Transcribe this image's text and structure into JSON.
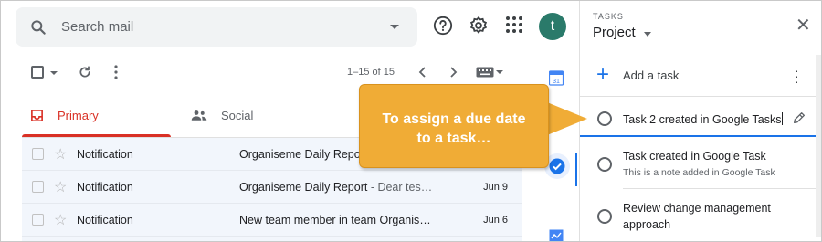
{
  "search": {
    "placeholder": "Search mail"
  },
  "avatar": {
    "initial": "t",
    "color": "#2a7a6a"
  },
  "toolbar": {
    "pagination": "1–15 of 15"
  },
  "tabs": [
    {
      "label": "Primary",
      "active": true
    },
    {
      "label": "Social",
      "active": false
    }
  ],
  "emails": [
    {
      "sender": "Notification",
      "subject": "Organiseme Daily Report",
      "snippet": "",
      "date": ""
    },
    {
      "sender": "Notification",
      "subject": "Organiseme Daily Report",
      "snippet": " - Dear tes…",
      "date": "Jun 9"
    },
    {
      "sender": "Notification",
      "subject": "New team member in team Organis…",
      "snippet": "",
      "date": "Jun 6"
    }
  ],
  "tasks_panel": {
    "header": "TASKS",
    "list_name": "Project",
    "add_label": "Add a task",
    "tasks": [
      {
        "title": "Task 2 created in Google Tasks",
        "note": ""
      },
      {
        "title": "Task created in Google Task",
        "note": "This is a note added in Google Task"
      },
      {
        "title": "Review change management approach",
        "title_line2": "approach",
        "title_line1": "Review change management",
        "note": ""
      }
    ]
  },
  "callout": {
    "line1": "To assign a due date",
    "line2": "to a task…"
  },
  "colors": {
    "accent": "#1a73e8",
    "primary_tab": "#d93025",
    "callout": "#f0ac36"
  },
  "icons": [
    "search-icon",
    "help-icon",
    "settings-icon",
    "apps-icon",
    "refresh-icon",
    "more-vert-icon",
    "chevron-left-icon",
    "chevron-right-icon",
    "keyboard-icon",
    "inbox-icon",
    "people-icon",
    "star-icon",
    "calendar-icon",
    "tasks-icon",
    "plus-icon",
    "close-icon",
    "edit-icon"
  ]
}
